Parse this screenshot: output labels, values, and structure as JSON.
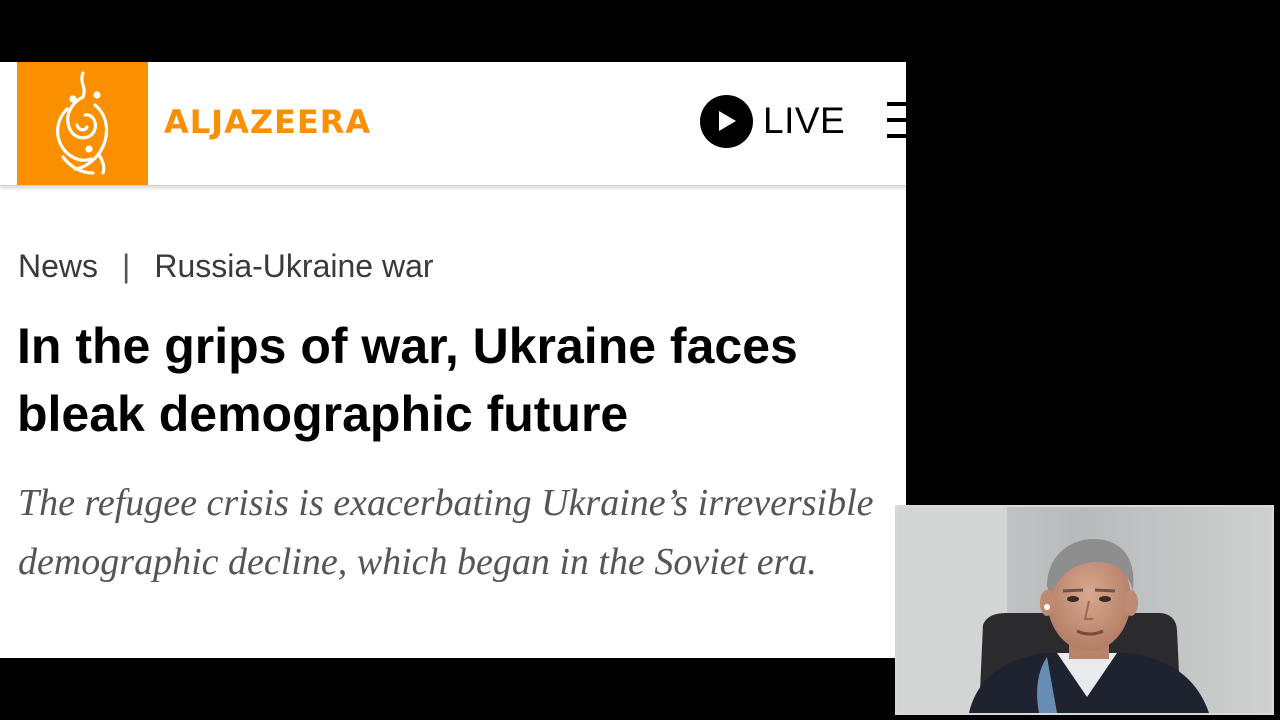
{
  "header": {
    "brand_name": "ALJAZEERA",
    "logo_icon": "aljazeera-calligraphy-logo",
    "live_icon": "play-icon",
    "live_label": "LIVE",
    "menu_icon": "hamburger-menu-icon"
  },
  "breadcrumb": {
    "section": "News",
    "separator": "|",
    "topic": "Russia-Ukraine war"
  },
  "article": {
    "title": "In the grips of war, Ukraine faces bleak demographic future",
    "subtitle": "The refugee crisis is exacerbating Ukraine’s irreversible demographic decline, which began in the Soviet era."
  },
  "colors": {
    "brand_orange": "#fa9000",
    "background": "#000000",
    "article_bg": "#ffffff",
    "title_text": "#000000",
    "subtitle_text": "#555555"
  }
}
